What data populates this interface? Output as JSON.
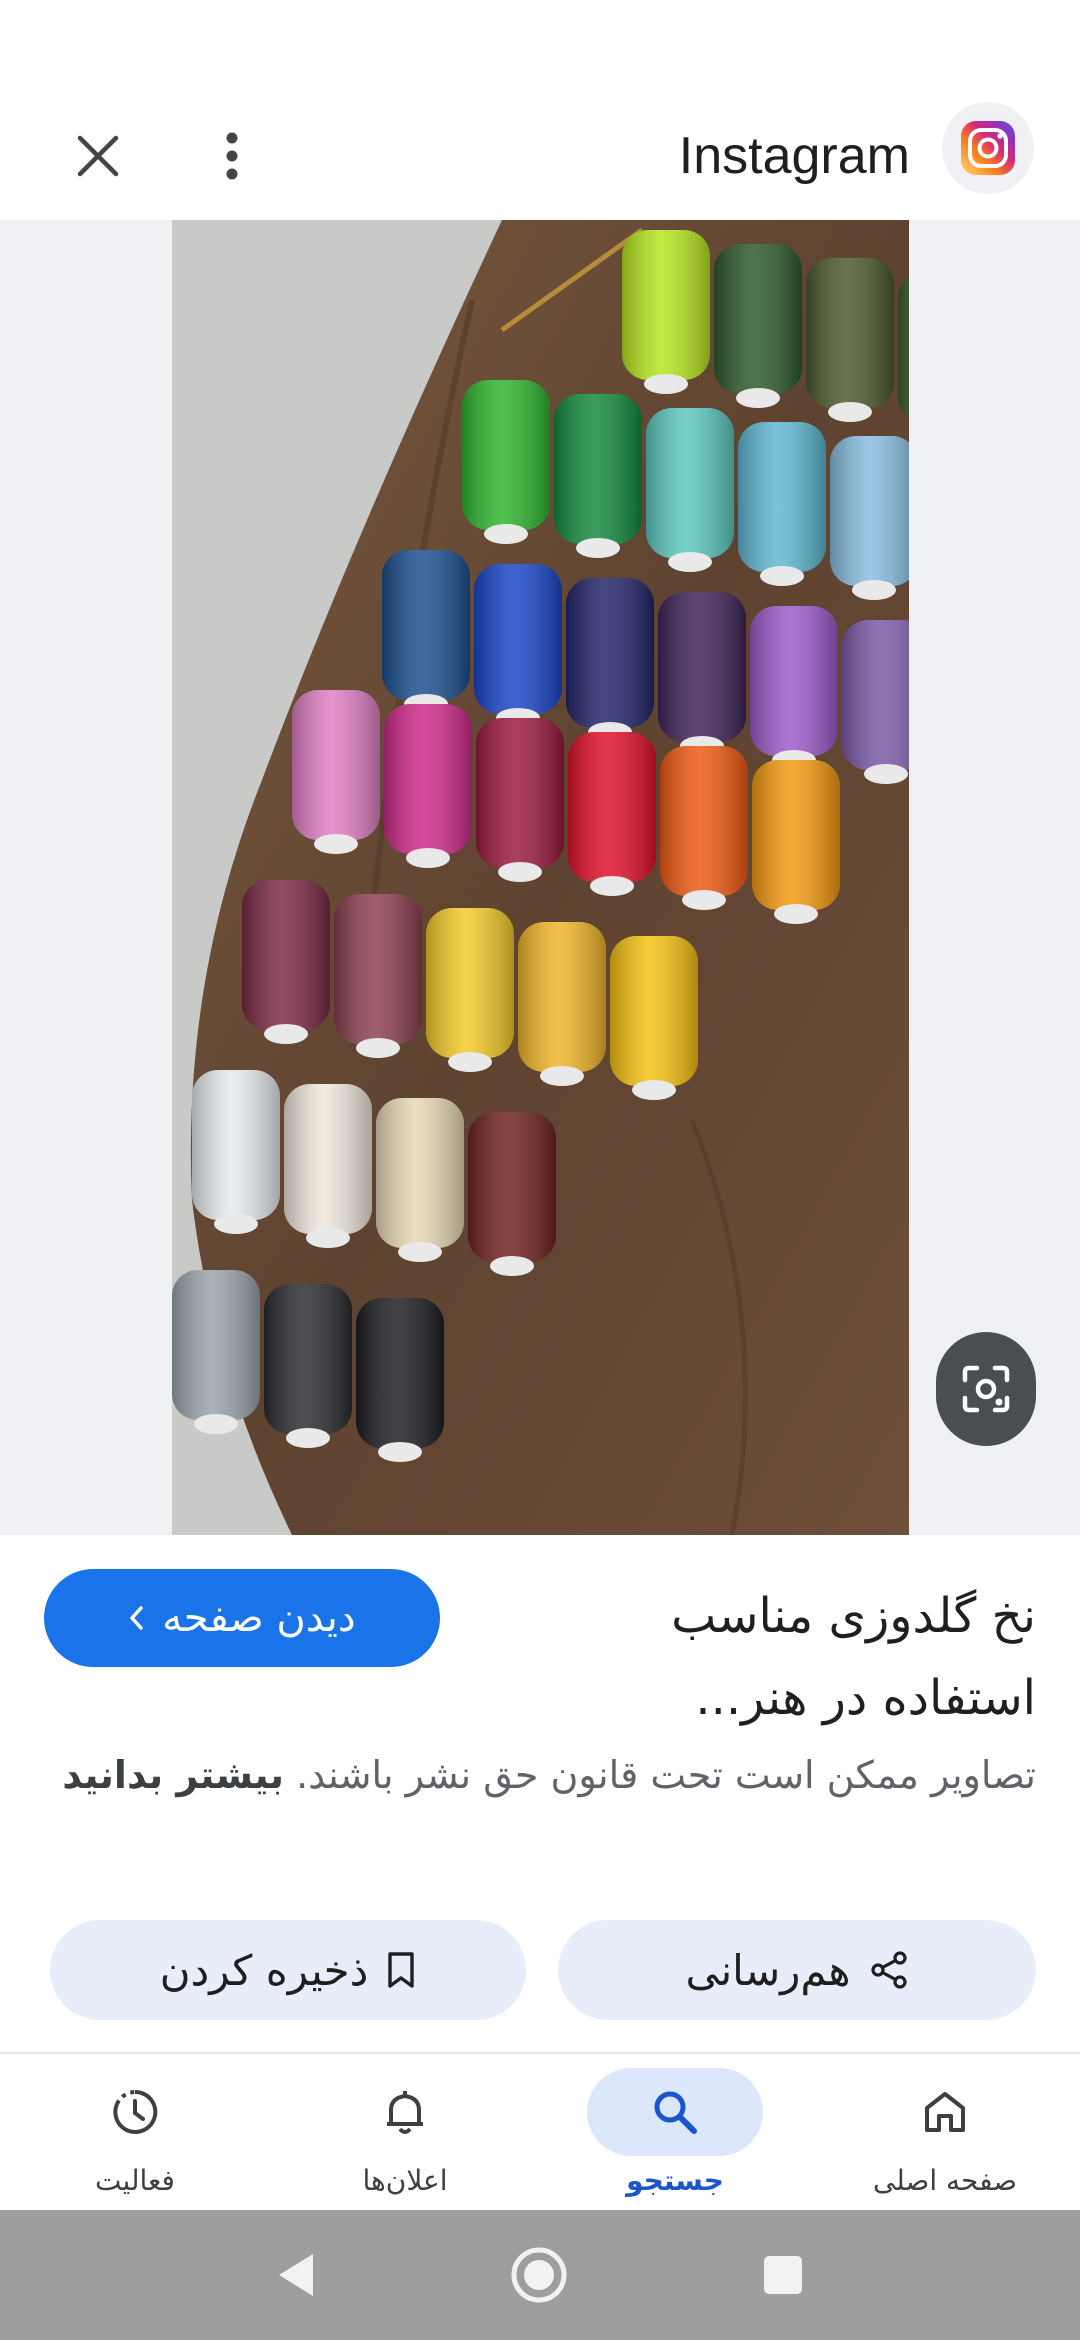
{
  "header": {
    "source_name": "Instagram",
    "close_icon": "close-icon",
    "more_icon": "more-vert-icon",
    "logo_icon": "instagram-logo"
  },
  "image": {
    "description_icon": "google-lens-icon"
  },
  "result": {
    "title": "نخ گلدوزی مناسب استفاده در هنر...",
    "visit_button_label": "دیدن صفحه",
    "copyright_text": "تصاویر ممکن است تحت قانون حق نشر باشند.",
    "learn_more_label": "بیشتر بدانید"
  },
  "actions": {
    "share_label": "هم‌رسانی",
    "save_label": "ذخیره کردن"
  },
  "bottom_nav": {
    "items": [
      {
        "label": "صفحه اصلی",
        "icon": "home-icon",
        "active": false
      },
      {
        "label": "جستجو",
        "icon": "search-icon",
        "active": true
      },
      {
        "label": "اعلان‌ها",
        "icon": "bell-icon",
        "active": false
      },
      {
        "label": "فعالیت",
        "icon": "activity-icon",
        "active": false
      }
    ]
  },
  "colors": {
    "accent": "#1a73e8",
    "pill_bg": "#e8eef9",
    "active_nav_bg": "#dce7fb"
  }
}
